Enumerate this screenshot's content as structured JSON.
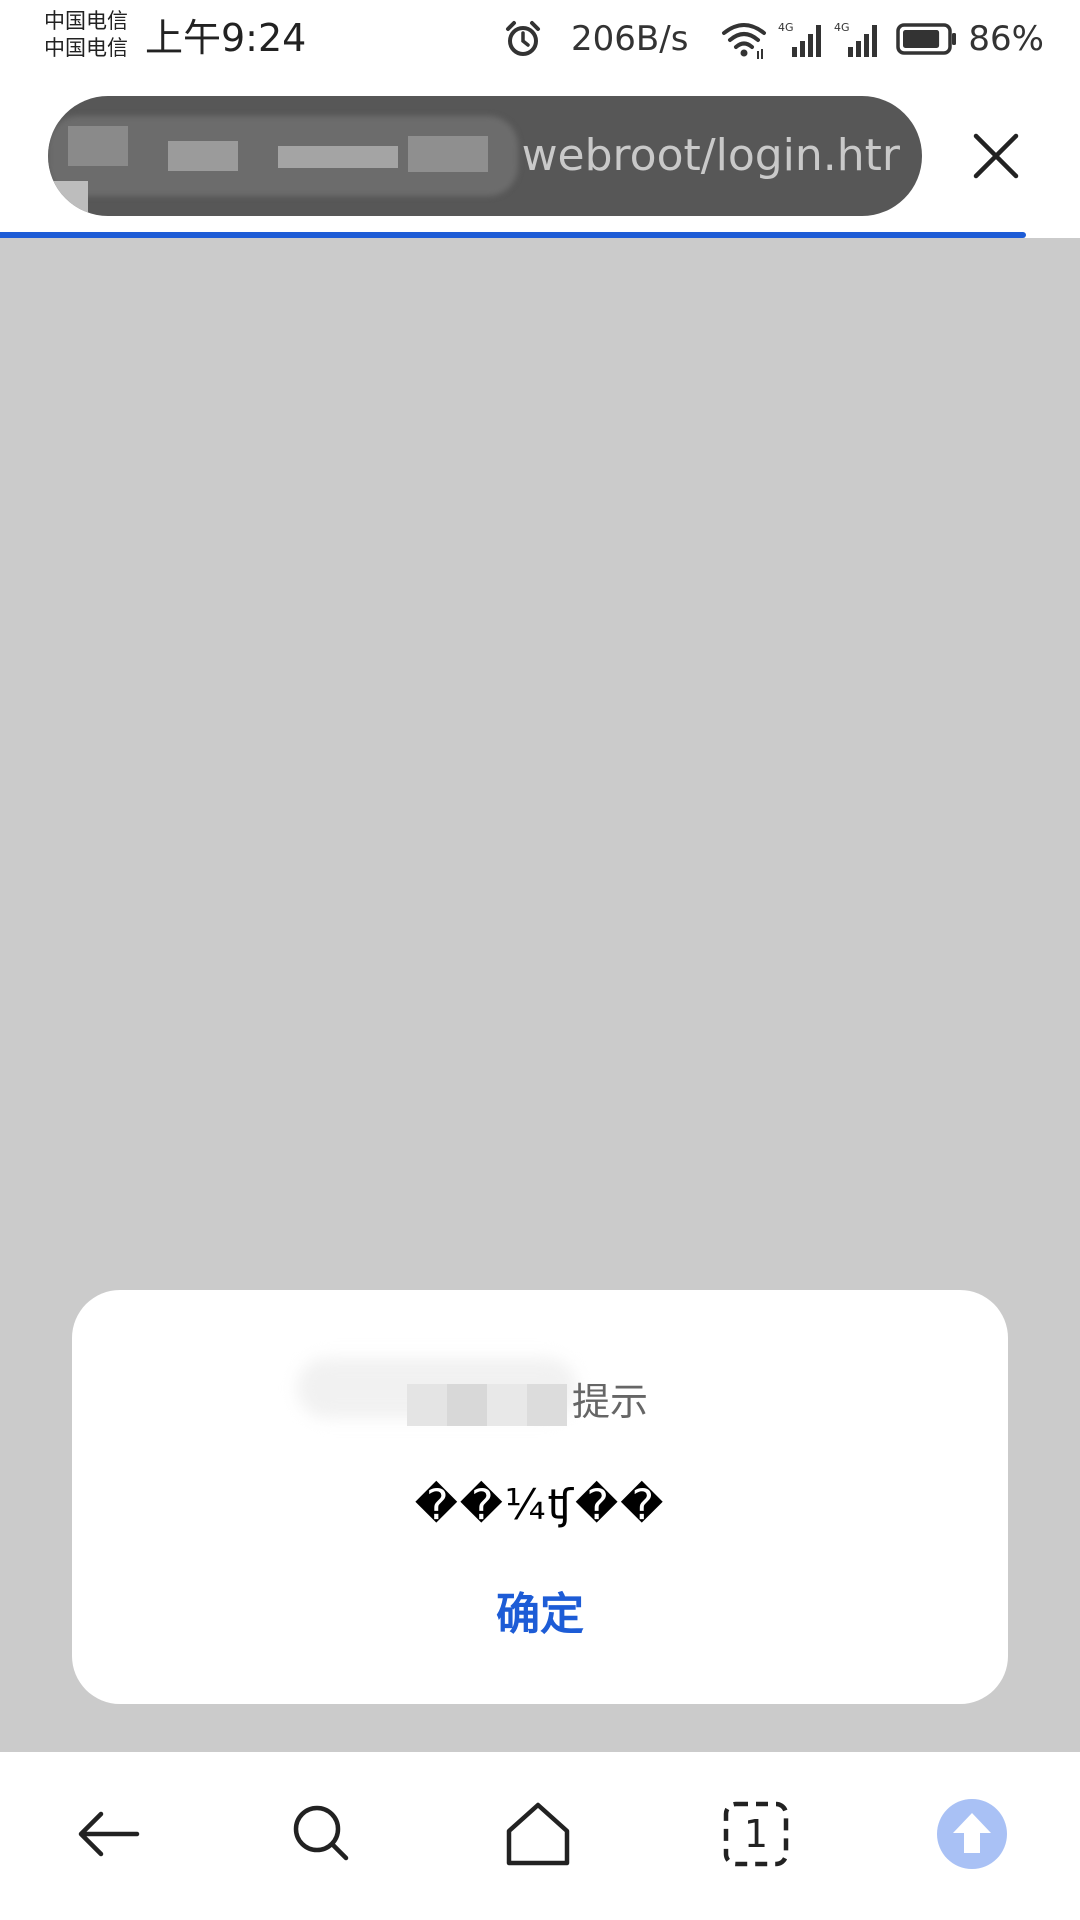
{
  "status_bar": {
    "carrier_1": "中国电信",
    "carrier_2": "中国电信",
    "time": "上午9:24",
    "network_speed": "206B/s",
    "signal_1_label": "4G",
    "signal_2_label": "4G",
    "battery": "86%",
    "battery_level": 0.86,
    "icons": [
      "alarm-icon",
      "wifi-icon",
      "signal-icon",
      "signal-icon",
      "battery-icon"
    ]
  },
  "address_bar": {
    "url_visible_text": "webroot/login.htr",
    "close_icon": "close-icon",
    "load_progress": 0.95
  },
  "dialog": {
    "title": "提示",
    "message": "��¼ʧ��",
    "ok_label": "确定"
  },
  "bottom_nav": {
    "items": [
      {
        "icon": "back-arrow-icon"
      },
      {
        "icon": "search-icon"
      },
      {
        "icon": "home-icon"
      },
      {
        "icon": "tabs-icon",
        "count": "1"
      },
      {
        "icon": "upload-icon"
      }
    ]
  },
  "colors": {
    "accent": "#1d5cd6",
    "page_background": "#cbcbcb",
    "url_pill": "#575757",
    "upload_button": "#a9c1f5"
  }
}
